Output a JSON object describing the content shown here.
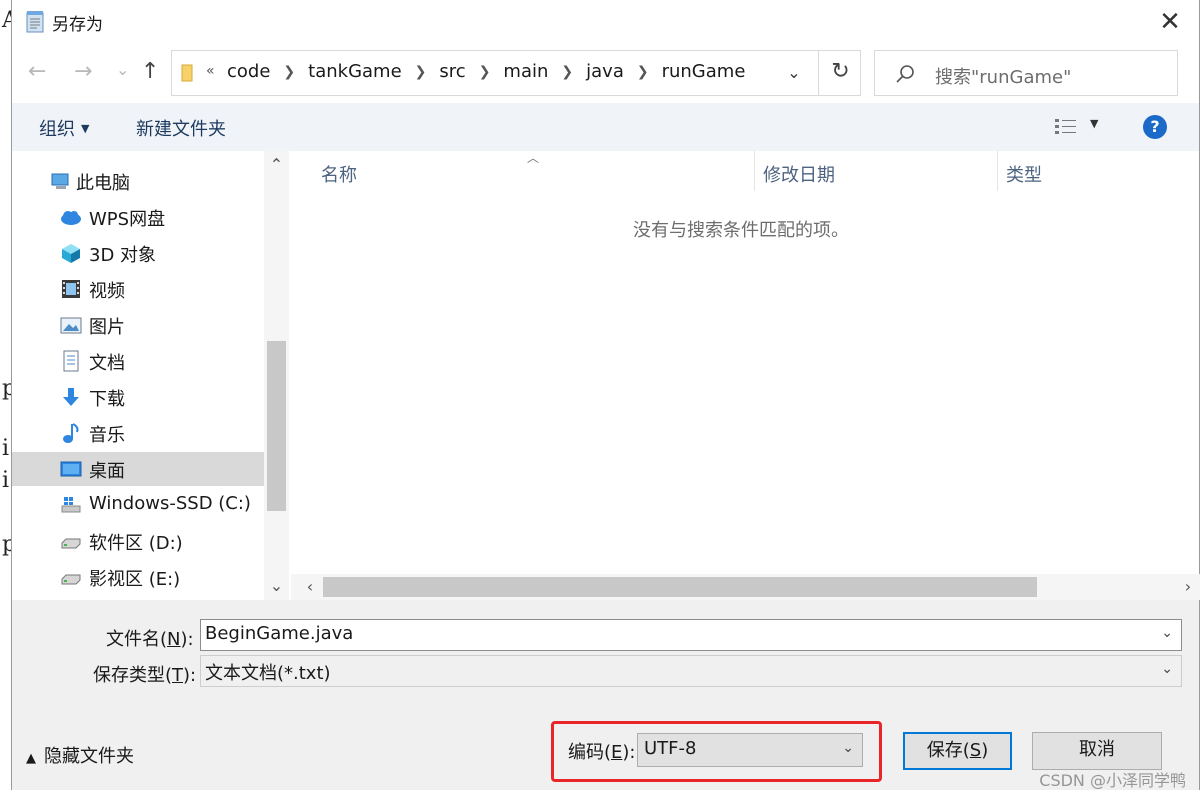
{
  "window": {
    "title": "另存为",
    "close_label": "✕"
  },
  "background": {
    "chars": [
      "A",
      "p",
      "i",
      "i",
      "p"
    ]
  },
  "nav": {
    "back": "←",
    "forward": "→",
    "recent": "⌄",
    "up": "↑"
  },
  "address": {
    "overflow": "«",
    "crumbs": [
      "code",
      "tankGame",
      "src",
      "main",
      "java",
      "runGame"
    ],
    "dropdown": "⌄",
    "refresh": "↻"
  },
  "search": {
    "placeholder": "搜索\"runGame\""
  },
  "toolbar": {
    "organize": "组织",
    "new_folder": "新建文件夹",
    "help": "?"
  },
  "sidebar": {
    "items": [
      {
        "label": "此电脑",
        "icon": "computer-icon"
      },
      {
        "label": "WPS网盘",
        "icon": "cloud-icon"
      },
      {
        "label": "3D 对象",
        "icon": "cube-icon"
      },
      {
        "label": "视频",
        "icon": "video-icon"
      },
      {
        "label": "图片",
        "icon": "picture-icon"
      },
      {
        "label": "文档",
        "icon": "document-icon"
      },
      {
        "label": "下载",
        "icon": "download-icon"
      },
      {
        "label": "音乐",
        "icon": "music-icon"
      },
      {
        "label": "桌面",
        "icon": "desktop-icon",
        "selected": true
      },
      {
        "label": "Windows-SSD (C:)",
        "icon": "windows-drive-icon"
      },
      {
        "label": "软件区 (D:)",
        "icon": "drive-icon"
      },
      {
        "label": "影视区 (E:)",
        "icon": "drive-icon"
      }
    ]
  },
  "filelist": {
    "columns": [
      "名称",
      "修改日期",
      "类型"
    ],
    "empty_message": "没有与搜索条件匹配的项。"
  },
  "form": {
    "filename_label": "文件名",
    "filename_key": "N",
    "filename_value": "BeginGame.java",
    "filetype_label": "保存类型",
    "filetype_key": "T",
    "filetype_value": "文本文档(*.txt)"
  },
  "footer": {
    "hide_folders": "隐藏文件夹",
    "encoding_label": "编码",
    "encoding_key": "E",
    "encoding_value": "UTF-8",
    "save_label": "保存",
    "save_key": "S",
    "cancel_label": "取消"
  },
  "watermark": "CSDN @小泽同学鸭",
  "colors": {
    "accent": "#0078d7",
    "highlight_border": "#e8262a",
    "toolbar_bg": "#f0f4f9",
    "help_icon": "#1b6ac9"
  }
}
